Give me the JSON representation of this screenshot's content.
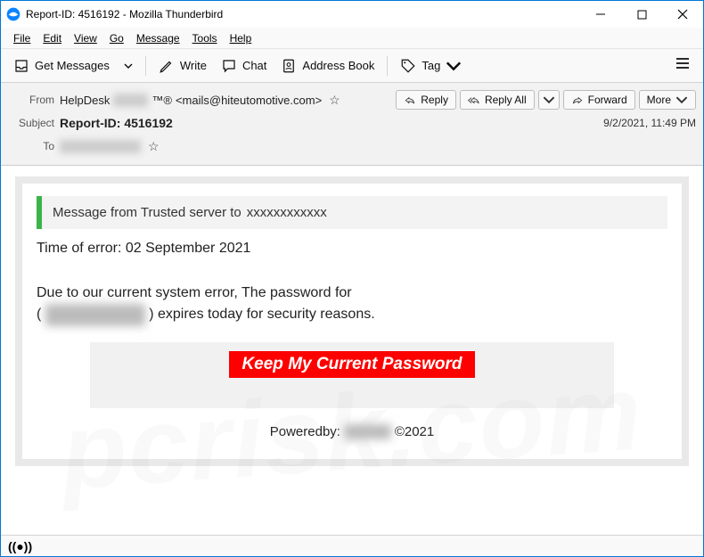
{
  "window": {
    "title": "Report-ID: 4516192 - Mozilla Thunderbird"
  },
  "menu": {
    "file": "File",
    "edit": "Edit",
    "view": "View",
    "go": "Go",
    "message": "Message",
    "tools": "Tools",
    "help": "Help"
  },
  "toolbar": {
    "get_messages": "Get Messages",
    "write": "Write",
    "chat": "Chat",
    "address_book": "Address Book",
    "tag": "Tag"
  },
  "headers": {
    "from_label": "From",
    "from_name": "HelpDesk",
    "from_hidden": "xxxxxx",
    "from_suffix": "™®",
    "from_email": "<mails@hiteutomotive.com>",
    "subject_label": "Subject",
    "subject_value": "Report-ID: 4516192",
    "to_label": "To",
    "to_hidden": "xxxxxxxxxxxxxx",
    "datetime": "9/2/2021, 11:49 PM",
    "actions": {
      "reply": "Reply",
      "reply_all": "Reply All",
      "forward": "Forward",
      "more": "More"
    }
  },
  "body": {
    "notice_prefix": "Message from Trusted server to",
    "notice_hidden": "xxxxxxxxxxxx",
    "time_of_error": "Time of error: 02 September 2021",
    "line1": "Due to our current system error, The password for",
    "line2_prefix": "( ",
    "line2_hidden": "xxxxxxxxxxxxxx",
    "line2_suffix": " ) expires today for security reasons.",
    "cta": "Keep My Current Password",
    "powered_prefix": "Poweredby:",
    "powered_hidden": "xxxxxxx",
    "powered_suffix": "©2021"
  },
  "watermark": "pcrisk.com"
}
